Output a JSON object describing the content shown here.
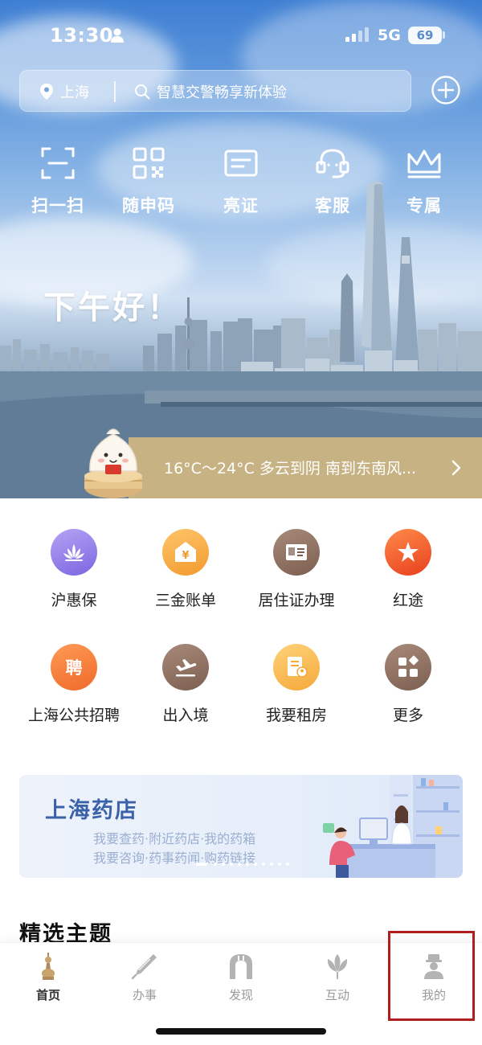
{
  "status_bar": {
    "time": "13:30",
    "network": "5G",
    "battery": "69"
  },
  "header": {
    "location": "上海",
    "search_placeholder": "智慧交警畅享新体验"
  },
  "quick_actions": [
    {
      "label": "扫一扫",
      "icon": "scan-icon"
    },
    {
      "label": "随申码",
      "icon": "qr-code-icon"
    },
    {
      "label": "亮证",
      "icon": "id-card-icon"
    },
    {
      "label": "客服",
      "icon": "headset-icon"
    },
    {
      "label": "专属",
      "icon": "crown-icon"
    }
  ],
  "greeting": "下午好！",
  "weather": {
    "text": "16°C～24°C 多云到阴 南到东南风..."
  },
  "services": [
    {
      "label": "沪惠保",
      "icon": "lotus-icon",
      "color": "#8b78e8"
    },
    {
      "label": "三金账单",
      "icon": "yuan-house-icon",
      "color": "#f4a646"
    },
    {
      "label": "居住证办理",
      "icon": "residence-card-icon",
      "color": "#8c6e5f"
    },
    {
      "label": "红途",
      "icon": "red-star-icon",
      "color": "#f05a2a"
    },
    {
      "label": "上海公共招聘",
      "icon": "recruit-icon",
      "color": "#f27b3a"
    },
    {
      "label": "出入境",
      "icon": "airplane-icon",
      "color": "#8c6e5f"
    },
    {
      "label": "我要租房",
      "icon": "rent-document-icon",
      "color": "#f6b548"
    },
    {
      "label": "更多",
      "icon": "more-grid-icon",
      "color": "#8c6e5f"
    }
  ],
  "recruit_glyph": "聘",
  "banner": {
    "title": "上海药店",
    "line1": "我要查药·附近药店·我的药箱",
    "line2": "我要咨询·药事药闻·购药链接"
  },
  "section_title": "精选主题",
  "tabs": [
    {
      "label": "首页",
      "icon": "home-tower-icon",
      "active": true
    },
    {
      "label": "办事",
      "icon": "pen-icon",
      "active": false
    },
    {
      "label": "发现",
      "icon": "arch-icon",
      "active": false
    },
    {
      "label": "互动",
      "icon": "magnolia-icon",
      "active": false
    },
    {
      "label": "我的",
      "icon": "profile-icon",
      "active": false
    }
  ],
  "colors": {
    "accent_gold": "#c7b284",
    "banner_title": "#3b61a8",
    "highlight_box": "#b01f1f"
  }
}
